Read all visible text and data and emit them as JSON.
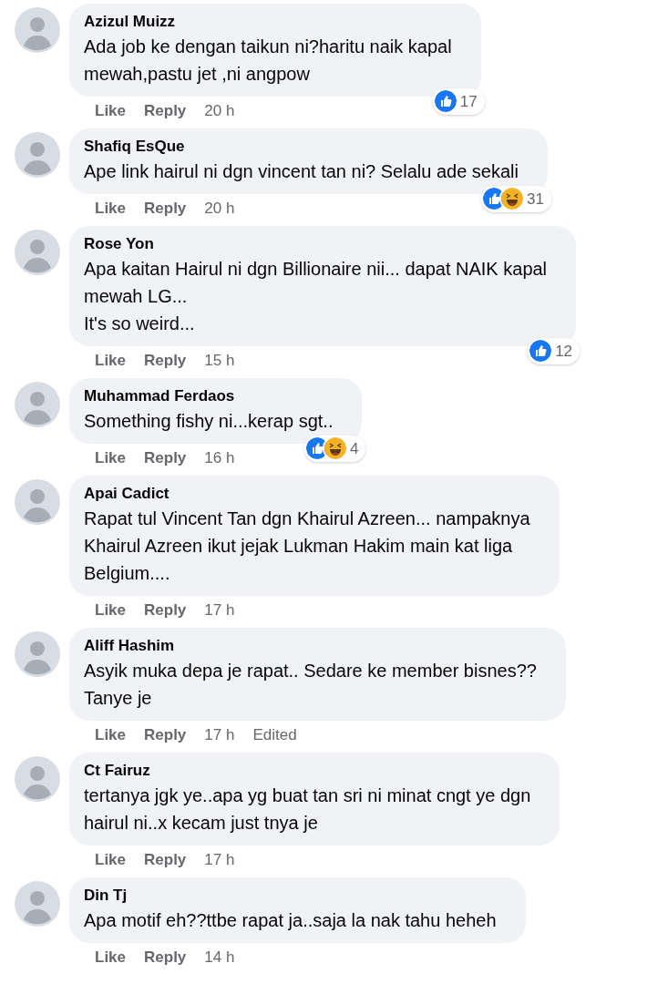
{
  "comments": [
    {
      "name": "Azizul Muizz",
      "text": "Ada job ke dengan taikun ni?haritu naik kapal\nmewah,pastu jet ,ni angpow",
      "actions": [
        "Like",
        "Reply"
      ],
      "time": "20 h",
      "reactions": {
        "like": true,
        "haha": false,
        "count": "17"
      }
    },
    {
      "name": "Shafiq EsQue",
      "text": "Ape link hairul ni dgn vincent tan ni? Selalu ade sekali",
      "actions": [
        "Like",
        "Reply"
      ],
      "time": "20 h",
      "reactions": {
        "like": true,
        "haha": true,
        "count": "31"
      }
    },
    {
      "name": "Rose Yon",
      "text": "Apa kaitan Hairul ni dgn Billionaire nii... dapat NAIK kapal\nmewah LG...\nIt's so weird...",
      "actions": [
        "Like",
        "Reply"
      ],
      "time": "15 h",
      "reactions": {
        "like": true,
        "haha": false,
        "count": "12"
      }
    },
    {
      "name": "Muhammad Ferdaos",
      "text": "Something fishy ni...kerap sgt..",
      "actions": [
        "Like",
        "Reply"
      ],
      "time": "16 h",
      "reactions": {
        "like": true,
        "haha": true,
        "count": "4"
      }
    },
    {
      "name": "Apai Cadict",
      "text": "Rapat tul Vincent Tan dgn Khairul Azreen... nampaknya\nKhairul Azreen ikut jejak Lukman Hakim main kat liga\nBelgium....",
      "actions": [
        "Like",
        "Reply"
      ],
      "time": "17 h"
    },
    {
      "name": "Aliff Hashim",
      "text": "Asyik muka depa je rapat.. Sedare ke member bisnes??\nTanye je",
      "actions": [
        "Like",
        "Reply"
      ],
      "time": "17 h",
      "edited": "Edited"
    },
    {
      "name": "Ct Fairuz",
      "text": "tertanya jgk ye..apa yg buat tan sri ni minat cngt ye dgn\nhairul ni..x kecam just tnya je",
      "actions": [
        "Like",
        "Reply"
      ],
      "time": "17 h"
    },
    {
      "name": "Din Tj",
      "text": "Apa motif eh??ttbe rapat ja..saja la nak tahu heheh",
      "actions": [
        "Like",
        "Reply"
      ],
      "time": "14 h"
    }
  ]
}
